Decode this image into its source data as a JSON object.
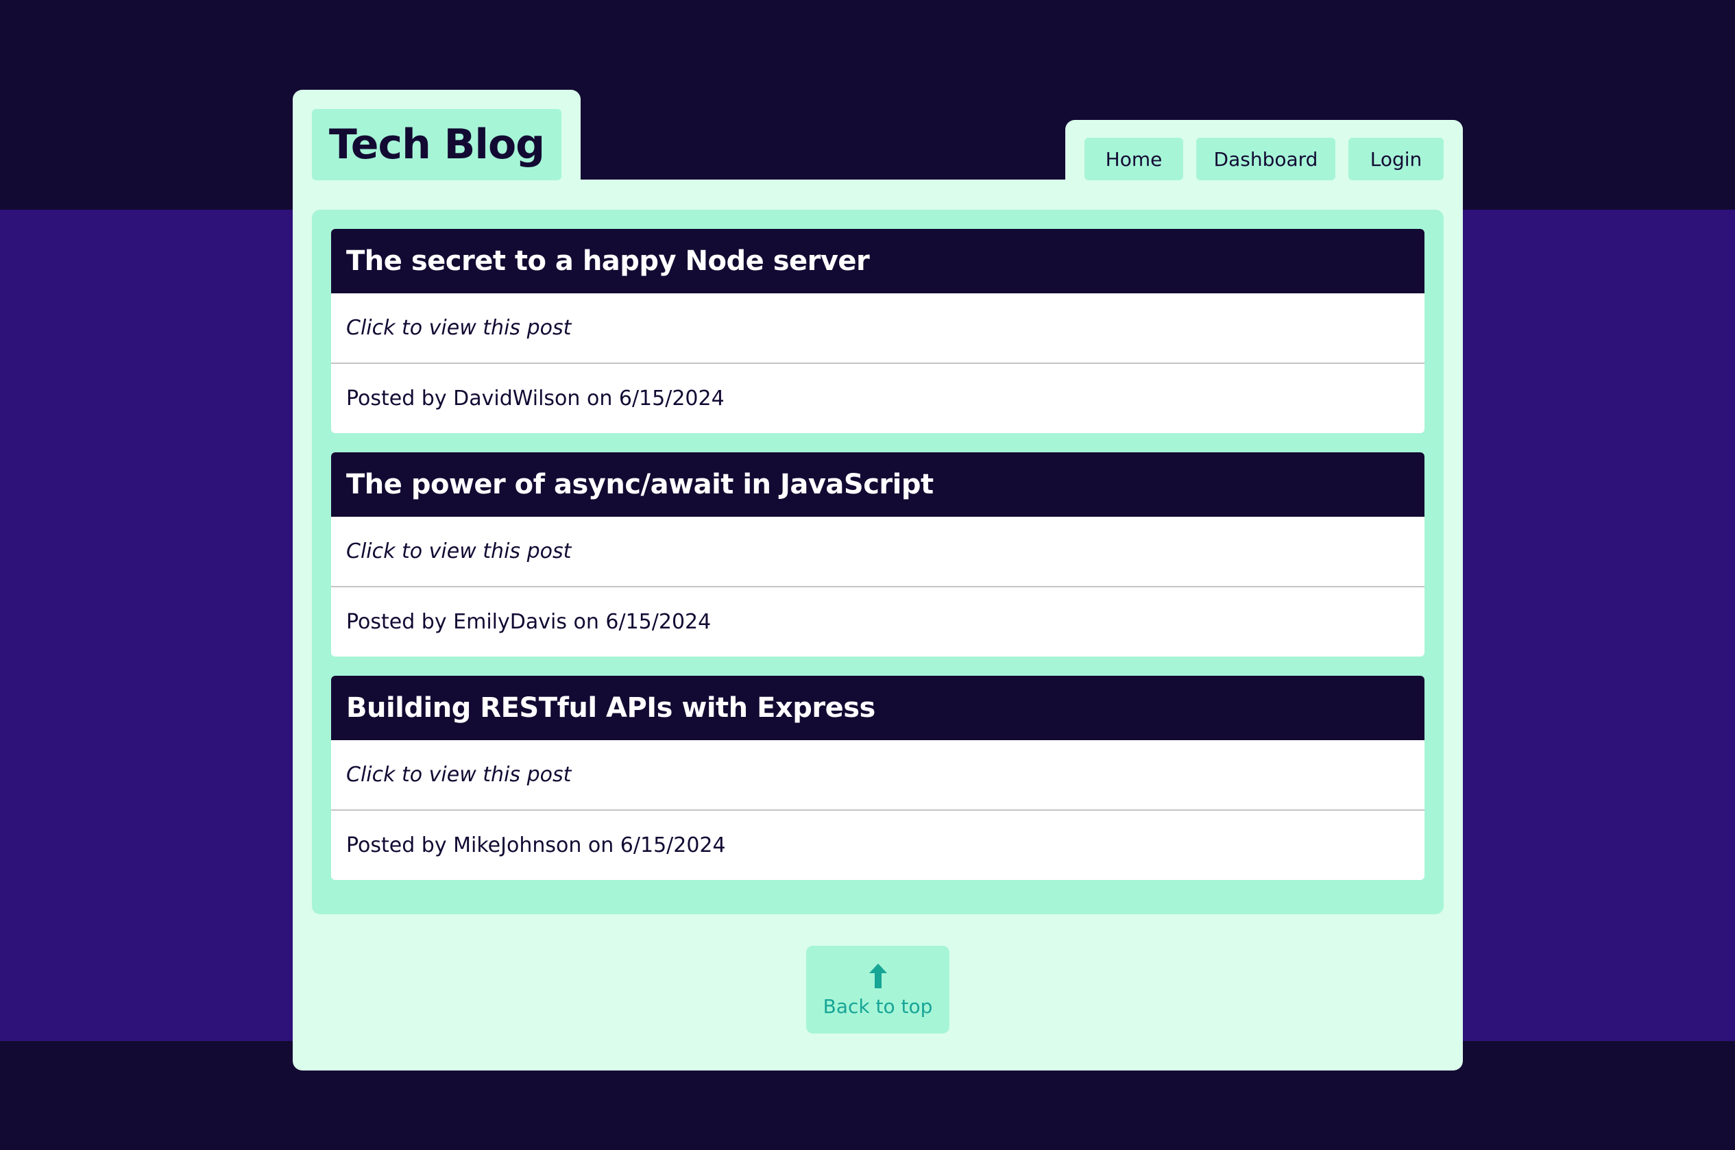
{
  "site": {
    "title": "Tech Blog"
  },
  "nav": {
    "items": [
      {
        "label": "Home"
      },
      {
        "label": "Dashboard"
      },
      {
        "label": "Login"
      }
    ]
  },
  "posts": [
    {
      "title": "The secret to a happy Node server",
      "hint": "Click to view this post",
      "meta": "Posted by DavidWilson on 6/15/2024"
    },
    {
      "title": "The power of async/await in JavaScript",
      "hint": "Click to view this post",
      "meta": "Posted by EmilyDavis on 6/15/2024"
    },
    {
      "title": "Building RESTful APIs with Express",
      "hint": "Click to view this post",
      "meta": "Posted by MikeJohnson on 6/15/2024"
    }
  ],
  "back_to_top": {
    "label": "Back to top",
    "icon": "arrow-up-icon"
  },
  "colors": {
    "background_dark": "#130a33",
    "background_band": "#2e127a",
    "card": "#dbfdeb",
    "accent_mint": "#a6f5d7",
    "teal": "#17a596"
  }
}
